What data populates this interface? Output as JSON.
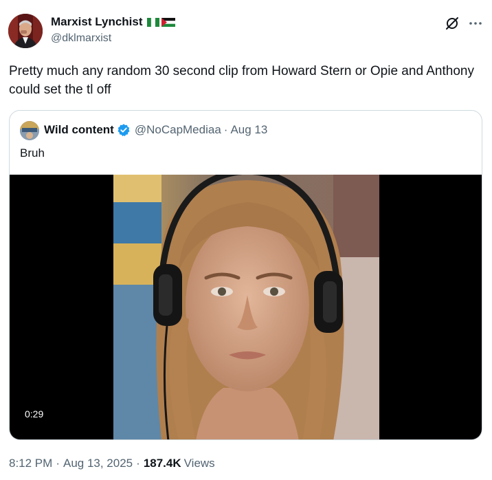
{
  "author": {
    "display_name": "Marxist Lynchist",
    "handle": "@dklmarxist",
    "flags": [
      "nigeria-flag",
      "palestine-flag"
    ]
  },
  "header_actions": {
    "grok_icon": "grok-icon",
    "more_icon": "more-icon"
  },
  "tweet": {
    "text": "Pretty much any random 30 second clip from Howard Stern or Opie and Anthony could set the tl off"
  },
  "quote": {
    "display_name": "Wild content",
    "verified": true,
    "handle": "@NoCapMediaa",
    "separator": "·",
    "date": "Aug 13",
    "text": "Bruh",
    "video": {
      "duration": "0:29"
    }
  },
  "meta": {
    "time": "8:12 PM",
    "separator": "·",
    "date": "Aug 13, 2025",
    "views_count": "187.4K",
    "views_label": "Views"
  },
  "colors": {
    "text_primary": "#0f1419",
    "text_secondary": "#536471",
    "border": "#cfd9de",
    "verified_blue": "#1d9bf0"
  }
}
